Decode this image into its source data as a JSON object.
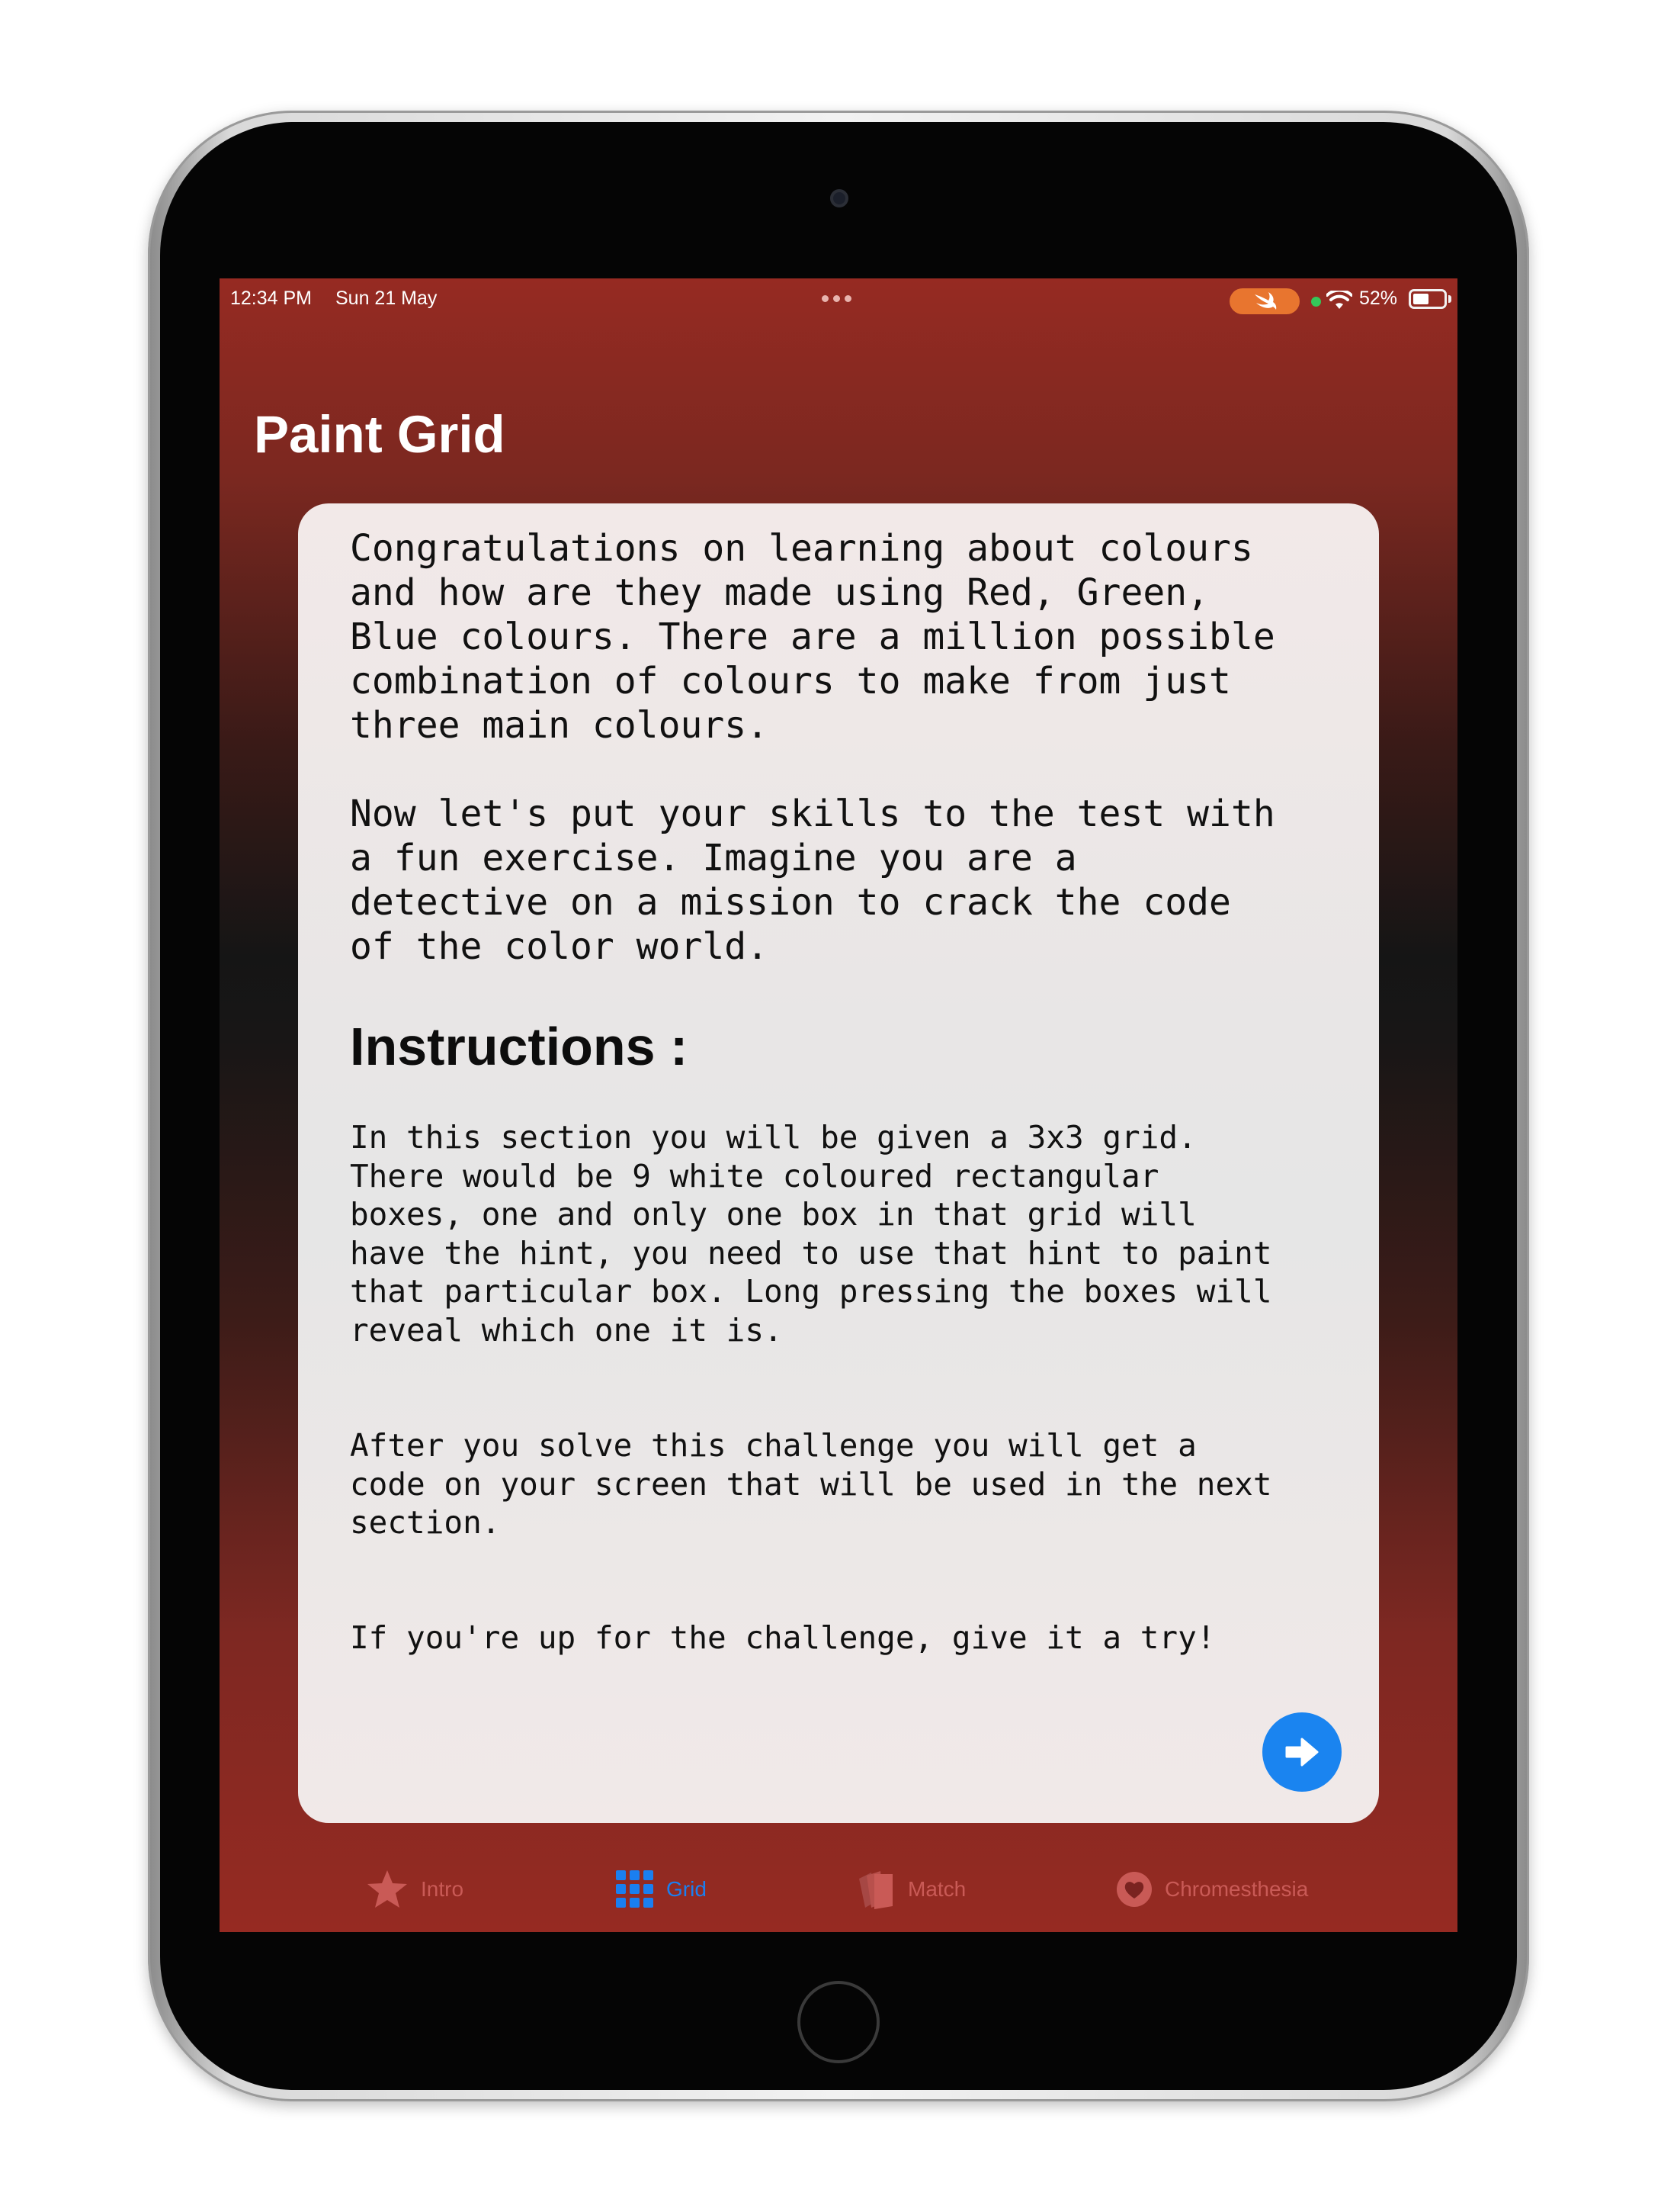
{
  "status_bar": {
    "time": "12:34 PM",
    "date": "Sun 21 May",
    "battery_percent": "52%",
    "battery_level": 0.52
  },
  "header": {
    "title": "Paint Grid"
  },
  "card": {
    "intro_paragraph_1": "Congratulations on learning about colours\nand how are they made using Red, Green,\nBlue colours. There are a million possible\ncombination of colours to make from just\nthree main colours.",
    "intro_paragraph_2": "Now let's put your skills to the test with\na fun exercise. Imagine you are a\ndetective on a mission to crack the code\nof the color world.",
    "instructions_heading": "Instructions :",
    "instructions_paragraph_1": "In this section you will be given a 3x3 grid.\nThere would be 9 white coloured rectangular\nboxes, one and only one box in that grid will\nhave the hint, you need to use that hint to paint\nthat particular box. Long pressing the boxes will\nreveal which one it is.",
    "instructions_paragraph_2": "After you solve this challenge you will get a\ncode on your screen that will be used in the next\nsection.",
    "instructions_paragraph_3": "If you're up for the challenge, give it a try!",
    "next_button_icon": "arrow-right-icon"
  },
  "tab_bar": {
    "tabs": [
      {
        "label": "Intro",
        "icon": "star-icon",
        "selected": false
      },
      {
        "label": "Grid",
        "icon": "grid-icon",
        "selected": true
      },
      {
        "label": "Match",
        "icon": "cards-icon",
        "selected": false
      },
      {
        "label": "Chromesthesia",
        "icon": "heart-icon",
        "selected": false
      }
    ]
  },
  "colors": {
    "accent": "#1a84f0",
    "background_red": "#962a22",
    "inactive_tab": "#c95a56"
  }
}
